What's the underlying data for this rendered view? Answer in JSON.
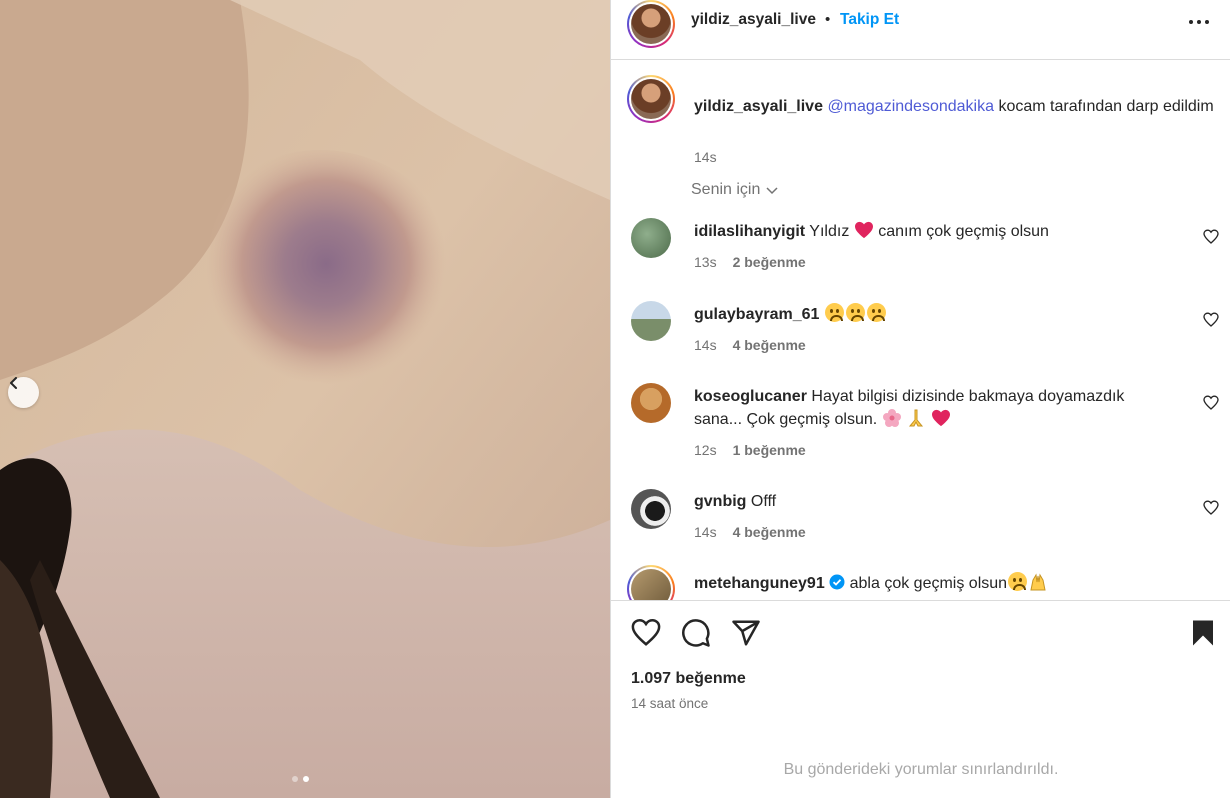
{
  "post": {
    "username": "yildiz_asyali_live",
    "separator": "•",
    "follow_label": "Takip Et",
    "more_icon": "more-horizontal-icon"
  },
  "caption": {
    "username": "yildiz_asyali_live",
    "mention": "@magazindesondakika",
    "text": "kocam tarafından darp edildim",
    "time": "14s"
  },
  "filter": {
    "label": "Senin için"
  },
  "comments": [
    {
      "username": "idilaslihanyigit",
      "text_before": "Yıldız",
      "emoji": [
        "red-heart"
      ],
      "text_after": "canım çok geçmiş olsun",
      "time": "13s",
      "likes": "2 beğenme"
    },
    {
      "username": "gulaybayram_61",
      "text_before": "",
      "emoji": [
        "sad-face",
        "sad-face",
        "sad-face"
      ],
      "text_after": "",
      "time": "14s",
      "likes": "4 beğenme"
    },
    {
      "username": "koseoglucaner",
      "text_before": "Hayat bilgisi dizisinde bakmaya doyamazdık sana... Çok geçmiş olsun.",
      "emoji": [
        "blossom",
        "folded-hands",
        "red-heart"
      ],
      "text_after": "",
      "time": "12s",
      "likes": "1 beğenme"
    },
    {
      "username": "gvnbig",
      "text_before": "Offf",
      "emoji": [],
      "text_after": "",
      "time": "14s",
      "likes": "4 beğenme"
    },
    {
      "username": "metehanguney91",
      "verified": true,
      "text_before": "abla çok geçmiş olsun",
      "emoji": [
        "sad-face",
        "raised-hands"
      ],
      "text_after": "",
      "time": "",
      "likes": ""
    }
  ],
  "actions": {
    "like_icon": "heart-icon",
    "comment_icon": "comment-icon",
    "share_icon": "send-icon",
    "save_icon": "bookmark-icon",
    "likes_count": "1.097 beğenme",
    "time_ago": "14 saat önce"
  },
  "footer": {
    "restricted_text": "Bu gönderideki yorumlar sınırlandırıldı."
  },
  "carousel": {
    "current": 2,
    "total": 2
  },
  "colors": {
    "accent": "#0095f6",
    "mention": "#4f5bd5",
    "muted": "#737373"
  }
}
